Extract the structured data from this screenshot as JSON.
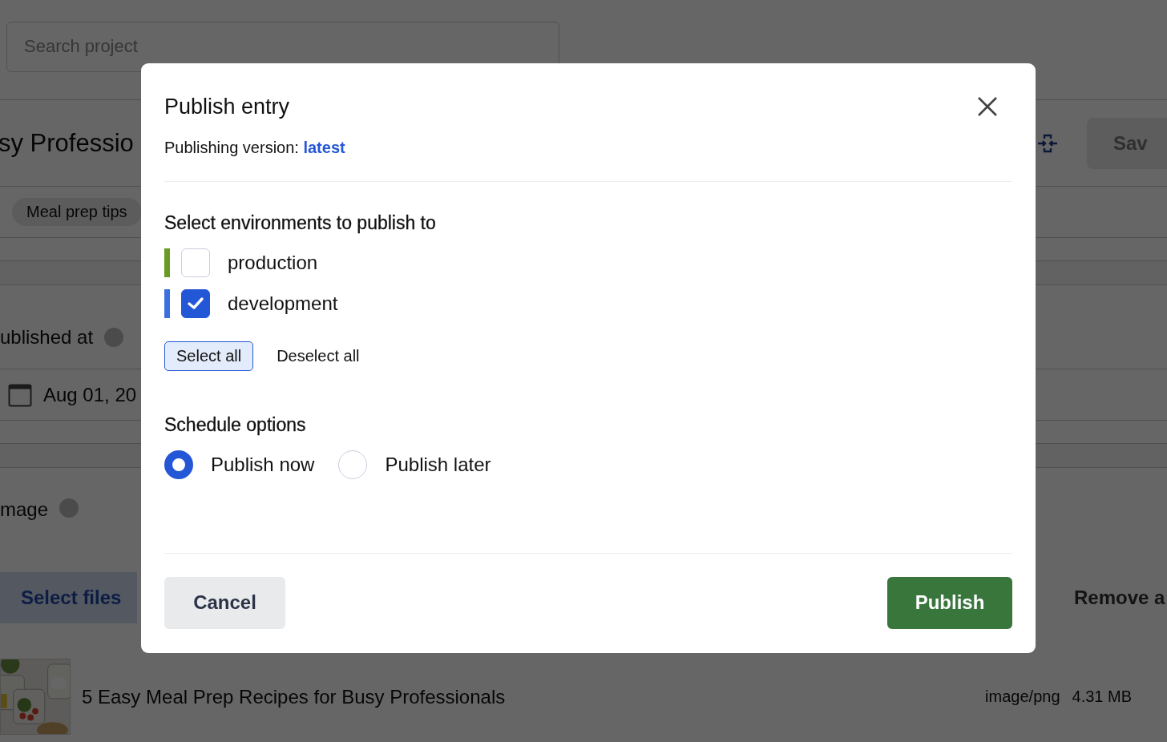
{
  "background": {
    "search": {
      "placeholder": "Search project"
    },
    "entry_title": "sy Professio",
    "save_button": "Sav",
    "tags": [
      "Meal prep tips"
    ],
    "published_label": "ublished at",
    "date_value": "Aug 01, 20",
    "image_label": "mage",
    "select_files_button": "Select files",
    "remove_button": "Remove a",
    "file": {
      "kind": "picture",
      "name": "5 Easy Meal Prep Recipes for Busy Professionals",
      "type": "image/png",
      "size": "4.31 MB"
    }
  },
  "dialog": {
    "title": "Publish entry",
    "version_label": "Publishing version:",
    "version_value": "latest",
    "environments_heading": "Select environments to publish to",
    "environments": [
      {
        "name": "production",
        "color": "#6a9a23",
        "checked": false
      },
      {
        "name": "development",
        "color": "#3b6fe0",
        "checked": true
      }
    ],
    "select_all": "Select all",
    "deselect_all": "Deselect all",
    "schedule_heading": "Schedule options",
    "schedule_options": [
      {
        "label": "Publish now",
        "selected": true
      },
      {
        "label": "Publish later",
        "selected": false
      }
    ],
    "cancel": "Cancel",
    "publish": "Publish"
  }
}
